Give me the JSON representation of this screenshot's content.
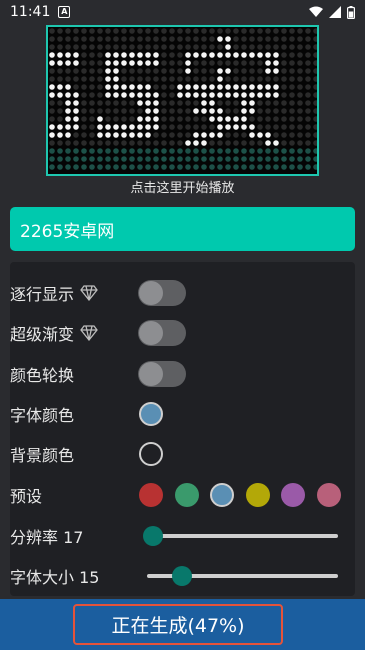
{
  "status_bar": {
    "time": "11:41",
    "a_badge": "A",
    "wifi_icon": "wifi-icon",
    "signal_icon": "cell-signal-icon",
    "battery_icon": "battery-icon"
  },
  "preview": {
    "led_text": "65安",
    "caption": "点击这里开始播放"
  },
  "input": {
    "value": "2265安卓网"
  },
  "settings": {
    "scroll_display_label": "逐行显示",
    "super_gradient_label": "超级渐变",
    "color_rotate_label": "颜色轮换",
    "font_color_label": "字体颜色",
    "bg_color_label": "背景颜色",
    "presets_label": "预设",
    "resolution_label": "分辨率 17",
    "font_size_label": "字体大小 15",
    "scroll_display_on": false,
    "super_gradient_on": false,
    "color_rotate_on": false,
    "font_color": "#5a8fb4",
    "bg_color": "#1f2024",
    "preset_colors": [
      "#b83232",
      "#3a9a6c",
      "#5a8fb4",
      "#b3a808",
      "#9a5aa8",
      "#b8607a"
    ],
    "resolution_value": 17,
    "font_size_value": 15
  },
  "bottom": {
    "generate_label": "正在生成(47%)",
    "progress": 0.47
  },
  "colors": {
    "accent": "#00c9ae",
    "bottom_bar": "#1b5e9f",
    "highlight_border": "#e5533a",
    "slider_thumb": "#08786b"
  }
}
